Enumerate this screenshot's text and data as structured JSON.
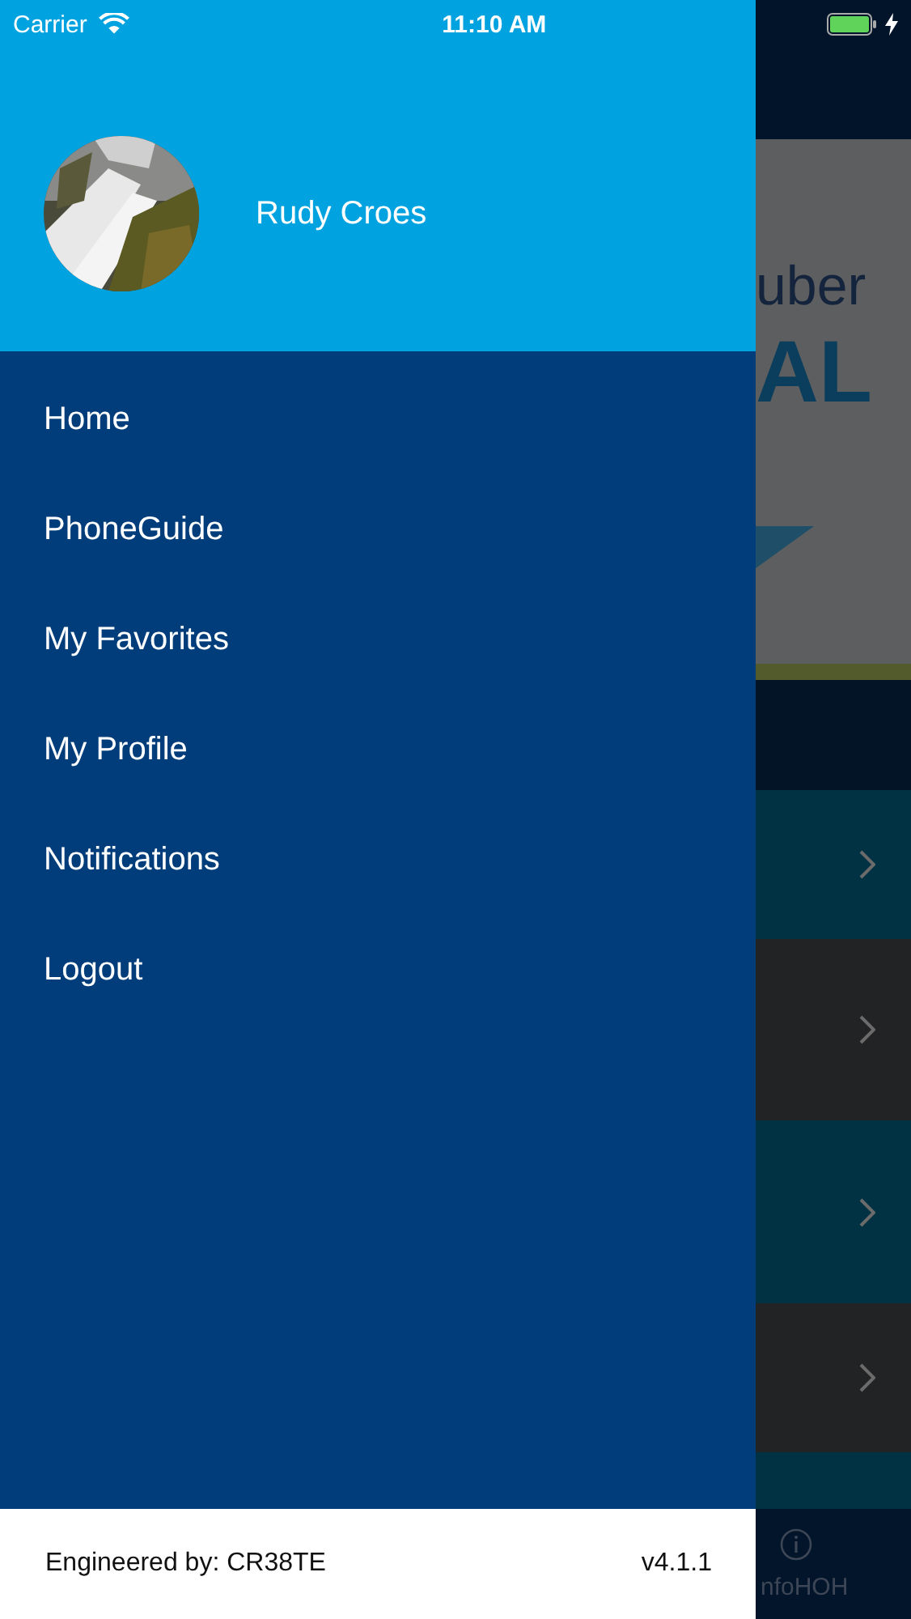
{
  "status_bar": {
    "carrier": "Carrier",
    "time": "11:10 AM"
  },
  "drawer": {
    "user_name": "Rudy Croes",
    "menu": [
      {
        "label": "Home"
      },
      {
        "label": "PhoneGuide"
      },
      {
        "label": "My Favorites"
      },
      {
        "label": "My Profile"
      },
      {
        "label": "Notifications"
      },
      {
        "label": "Logout"
      }
    ],
    "footer": {
      "credit": "Engineered by: CR38TE",
      "version": "v4.1.1"
    }
  },
  "background": {
    "banner": {
      "line_1": "uber",
      "line_2": "AL"
    },
    "rows": [
      {
        "kind": "teal"
      },
      {
        "kind": "dark"
      },
      {
        "kind": "teal"
      },
      {
        "kind": "dark"
      },
      {
        "kind": "teal"
      }
    ],
    "tab_label": "nfoHOH"
  }
}
